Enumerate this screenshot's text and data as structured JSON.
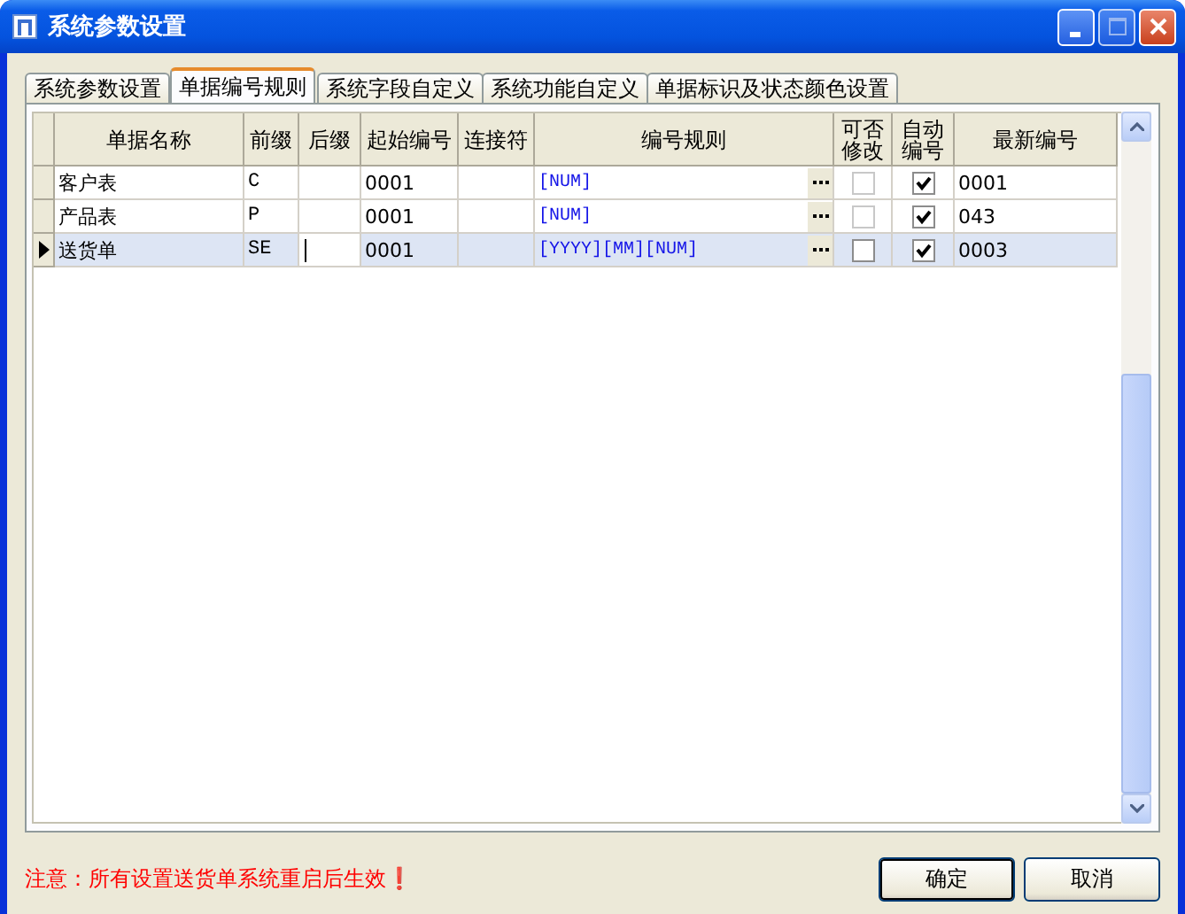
{
  "window": {
    "title": "系统参数设置"
  },
  "tabs": [
    {
      "label": "系统参数设置",
      "selected": false
    },
    {
      "label": "单据编号规则",
      "selected": true
    },
    {
      "label": "系统字段自定义",
      "selected": false
    },
    {
      "label": "系统功能自定义",
      "selected": false
    },
    {
      "label": "单据标识及状态颜色设置",
      "selected": false
    }
  ],
  "table": {
    "columns": [
      "单据名称",
      "前缀",
      "后缀",
      "起始编号",
      "连接符",
      "编号规则",
      "可否修改",
      "自动编号",
      "最新编号"
    ],
    "rows": [
      {
        "name": "客户表",
        "prefix": "C",
        "suffix": "",
        "start": "0001",
        "connector": "",
        "rule": "[NUM]",
        "editable": false,
        "auto_number": true,
        "latest": "0001",
        "selected": false
      },
      {
        "name": "产品表",
        "prefix": "P",
        "suffix": "",
        "start": "0001",
        "connector": "",
        "rule": "[NUM]",
        "editable": false,
        "auto_number": true,
        "latest": "043",
        "selected": false
      },
      {
        "name": "送货单",
        "prefix": "SE",
        "suffix": "",
        "start": "0001",
        "connector": "",
        "rule": "[YYYY][MM][NUM]",
        "editable": false,
        "auto_number": true,
        "latest": "0003",
        "selected": true
      }
    ]
  },
  "note": "注意：所有设置送货单系统重启后生效❗",
  "buttons": [
    "确定",
    "取消"
  ]
}
